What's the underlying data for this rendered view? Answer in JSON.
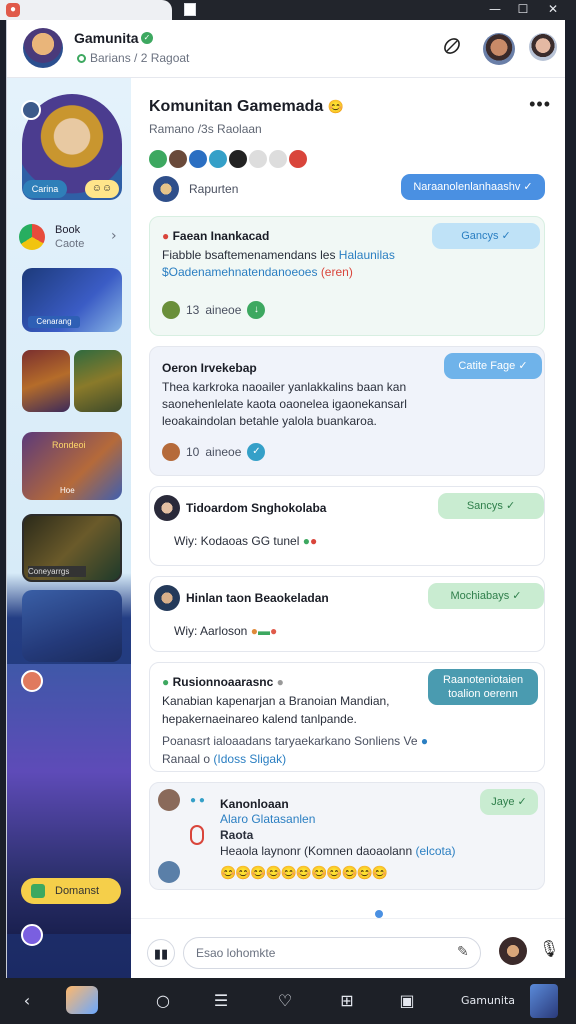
{
  "window": {
    "app_icon": "app-icon",
    "controls": [
      "—",
      "☐",
      "✕"
    ]
  },
  "group": {
    "name": "Gamunita",
    "subtitle": "Barians / 2 Ragoat"
  },
  "channel": {
    "title": "Komunitan Gamemada",
    "subtitle": "Ramano /3s Raolaan",
    "top_user": "Rapurten",
    "top_pill": "Naraanolenlanhaashv"
  },
  "sidebar": {
    "profile_label": "Carina",
    "item": {
      "title": "Book",
      "sub": "Caote"
    },
    "cards": [
      "Cenarang",
      "",
      "Rondeoi",
      "Hoe",
      "Coneyarrgs",
      "",
      "Domanst"
    ]
  },
  "messages": [
    {
      "title": "Faean Inankacad",
      "body1": "Fiabble bsaftemenamendans les",
      "body1_link": "Halaunilas",
      "body2_link": "$Oadenamehnatendanoeoes",
      "body2_tag": "(eren)",
      "pill": "Gancys",
      "reaction_count": "13",
      "reaction_label": "aineoe"
    },
    {
      "title": "Oeron Irvekebap",
      "body": "Thea karkroka naoailer yanlakkalins baan kan saonehenlelate kaota oaonelea igaonekansarl leoakaindolan betahle yalola buankaroa.",
      "pill": "Catite Fage",
      "reaction_count": "10",
      "reaction_label": "aineoe"
    },
    {
      "title": "Tidoardom Snghokolaba",
      "body": "Wiy: Kodaoas GG tunel",
      "pill": "Sancys"
    },
    {
      "title": "Hinlan taon Beaokeladan",
      "body": "Wiy: Aarloson",
      "pill": "Mochiabays"
    },
    {
      "title": "Rusionnoaarasnc",
      "body1": "Kanabian kapenarjan a Branoian Mandian,",
      "body2": "hepakernaeinareo kalend tanlpande.",
      "body3": "Poanasrt ialoaadans taryaekarkano Sonliens Ve",
      "body4_prefix": "Ranaal o",
      "body4_link": "(Idoss Sligak)",
      "pill_line1": "Raanoteniotaien",
      "pill_line2": "toalion oerenn"
    },
    {
      "title": "Kanonloaan",
      "link": "Alaro Glatasanlen",
      "sub_title": "Raota",
      "body": "Heaola laynonr (Komnen daoaolann",
      "body_link": "(elcota)",
      "pill": "Jaye"
    }
  ],
  "composer": {
    "placeholder": "Esao lohomkte"
  },
  "colors": {
    "accent": "#4a90e2",
    "green": "#3da860",
    "sidebar_dark": "#1b2a64"
  }
}
